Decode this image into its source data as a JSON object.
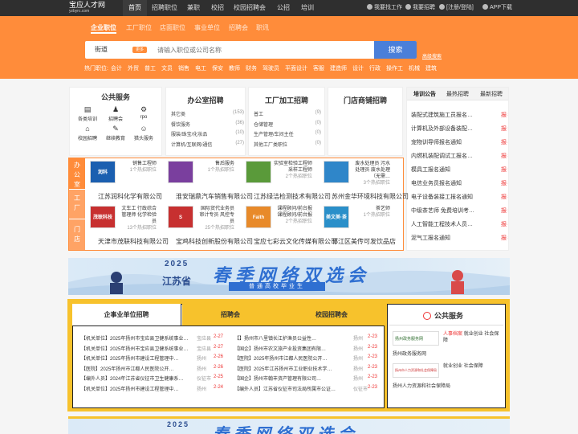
{
  "site": {
    "logo_main": "宝应人才网",
    "logo_sub": "yzbyrc.com"
  },
  "topnav": [
    "首页",
    "招聘职位",
    "兼职",
    "校招",
    "校园招聘会",
    "公招",
    "培训"
  ],
  "topright": {
    "find_job": "我要找工作",
    "recruit": "我要招聘",
    "login": "[注册/登陆]",
    "app": "APP下载"
  },
  "category_tabs": [
    "企业职位",
    "工厂职位",
    "店面职位",
    "事业单位",
    "招聘会",
    "职讯"
  ],
  "search": {
    "city": "街道",
    "city_tag": "更多",
    "placeholder": "请输入职位或公司名称",
    "button": "搜索",
    "advanced": "高级搜索"
  },
  "hot": {
    "label": "热门职位:",
    "items": [
      "会计",
      "外贸",
      "普工",
      "文员",
      "销售",
      "电工",
      "保安",
      "教师",
      "财务",
      "驾驶员",
      "平面设计",
      "客服",
      "建造师",
      "设计",
      "行政",
      "操作工",
      "机械",
      "建筑"
    ]
  },
  "public_service": {
    "title": "公共服务",
    "items": [
      {
        "label": "各类培训",
        "icon": "book-icon"
      },
      {
        "label": "招聘会",
        "icon": "people-icon"
      },
      {
        "label": "rpo",
        "icon": "gear-icon"
      },
      {
        "label": "校园招聘",
        "icon": "school-icon"
      },
      {
        "label": "继续教育",
        "icon": "education-icon"
      },
      {
        "label": "猎头服务",
        "icon": "headhunter-icon"
      }
    ]
  },
  "office": {
    "title": "办公室招聘",
    "rows": [
      {
        "name": "其它类",
        "count": "(153)"
      },
      {
        "name": "餐饮服务",
        "count": "(36)"
      },
      {
        "name": "服装/珠宝/化妆品",
        "count": "(10)"
      },
      {
        "name": "计算机/互联网/通信",
        "count": "(27)"
      }
    ]
  },
  "factory": {
    "title": "工厂加工招聘",
    "rows": [
      {
        "name": "普工",
        "count": "(9)"
      },
      {
        "name": "仓储管理",
        "count": "(0)"
      },
      {
        "name": "生产管理/车间主任",
        "count": "(0)"
      },
      {
        "name": "其他工厂类职位",
        "count": "(0)"
      }
    ]
  },
  "store": {
    "title": "门店商铺招聘"
  },
  "notice": {
    "tabs": [
      "培训公告",
      "最热招聘",
      "最新招聘"
    ],
    "rows": [
      {
        "text": "装配式建筑施工员报名…",
        "tag": "报名"
      },
      {
        "text": "计算机及外部设备装配…",
        "tag": "报名"
      },
      {
        "text": "宠物训导师报名通知",
        "tag": "报名"
      },
      {
        "text": "内燃机装配调试工报名…",
        "tag": "报名"
      },
      {
        "text": "模具工报名通知",
        "tag": "报名"
      },
      {
        "text": "电信业务员报名通知",
        "tag": "报名"
      },
      {
        "text": "电子设备装接工报名通知",
        "tag": "报名"
      },
      {
        "text": "中级茶艺师 免费培训考…",
        "tag": "报名"
      },
      {
        "text": "人工智能工程技术人员…",
        "tag": "报名"
      },
      {
        "text": "泥气工报名通知",
        "tag": "报名"
      }
    ]
  },
  "side_labels": [
    "办公室",
    "工厂",
    "门店"
  ],
  "companies": [
    {
      "title": "销售工程师",
      "count": "1个热招职位",
      "name": "江苏润科化学有限公司",
      "logo": "润科"
    },
    {
      "title": "售后服务",
      "count": "1个热招职位",
      "name": "淮安瑞鼎汽车销售有限公司",
      "logo": ""
    },
    {
      "title": "实验室检验工程师 采样工程师",
      "count": "2个热招职位",
      "name": "江苏绿洁检测技术有限公司",
      "logo": ""
    },
    {
      "title": "废水处理员 污水处理员 废水处理（无需…",
      "count": "3个热招职位",
      "name": "苏州金华环境科技有限公司",
      "logo": ""
    },
    {
      "title": "文车工 行政综合管理师 化学检验员",
      "count": "13个热招职位",
      "name": "天津市茂联科技有限公司",
      "logo": "茂联科技"
    },
    {
      "title": "国际贸代业务员 审计专员 风控专员",
      "count": "25个热招职位",
      "name": "宝鸡科技创新股份有限公司",
      "logo": "S"
    },
    {
      "title": "课程顾问/前台报 课程顾问/前台报",
      "count": "2个热招职位",
      "name": "宝应七彩云文化传媒有限公司",
      "logo": "Faith"
    },
    {
      "title": "茶艺师",
      "count": "1个热招职位",
      "name": "邗江区美传可发饮品店",
      "logo": "美文美·茶"
    }
  ],
  "banner": {
    "year": "2025",
    "province": "江苏省",
    "title": "春季网络双选会",
    "subtitle": "普通高校毕业生"
  },
  "bottom_tabs": [
    "企事业单位招聘",
    "招聘会",
    "校园招聘会"
  ],
  "left_list": [
    {
      "text": "【机关单位】2025年扬州市宝应县卫健系统事业…",
      "loc": "宝应县",
      "date": "2-27"
    },
    {
      "text": "【机关单位】2025年扬州市宝应县卫健系统事业…",
      "loc": "宝应县",
      "date": "2-27"
    },
    {
      "text": "【机关单位】2025年扬州市建设工程管理中…",
      "loc": "扬州",
      "date": "2-26"
    },
    {
      "text": "【医院】2025年扬州市江都人民医院公开…",
      "loc": "扬州",
      "date": "2-26"
    },
    {
      "text": "【编外人员】2024年江苏省仪征市卫生健康系…",
      "loc": "仪征市",
      "date": "2-25"
    },
    {
      "text": "【机关单位】2025年扬州市建设工程管理中…",
      "loc": "扬州",
      "date": "2-24"
    }
  ],
  "mid_list": [
    {
      "text": "【】扬州市八里镇长江护渔员公益性…",
      "loc": "扬州",
      "date": "2-23"
    },
    {
      "text": "【国企】扬州市农文旅产业投资集团有限…",
      "loc": "扬州",
      "date": "2-23"
    },
    {
      "text": "【医院】2025年扬州市江都人民医院公开…",
      "loc": "扬州",
      "date": "2-23"
    },
    {
      "text": "【医院】2025年江苏扬州市工业职业技术学…",
      "loc": "扬州",
      "date": "2-23"
    },
    {
      "text": "【国企】扬州市翰丰资产管理有限公司…",
      "loc": "扬州",
      "date": "2-23"
    },
    {
      "text": "【编外人员】江苏省仪征市司法局所属市公证…",
      "loc": "仪征市",
      "date": "2-23"
    }
  ],
  "right_service": {
    "title": "公共服务",
    "items": [
      {
        "logo": "扬州政务服务网",
        "tags": [
          "人事档案",
          "就业创业",
          "社会保障"
        ],
        "caption": "扬州政务服务网"
      },
      {
        "logo": "扬州市人力资源和社会保障局",
        "tags": [
          "就业创业",
          "社会保障"
        ],
        "caption": "扬州人力资源和社会保障局"
      }
    ]
  },
  "colors": {
    "orange": "#ff8c3a",
    "dark": "#2f2f2f",
    "blue": "#4a7fd9",
    "red": "#e33",
    "yellow": "#f7c22c"
  }
}
